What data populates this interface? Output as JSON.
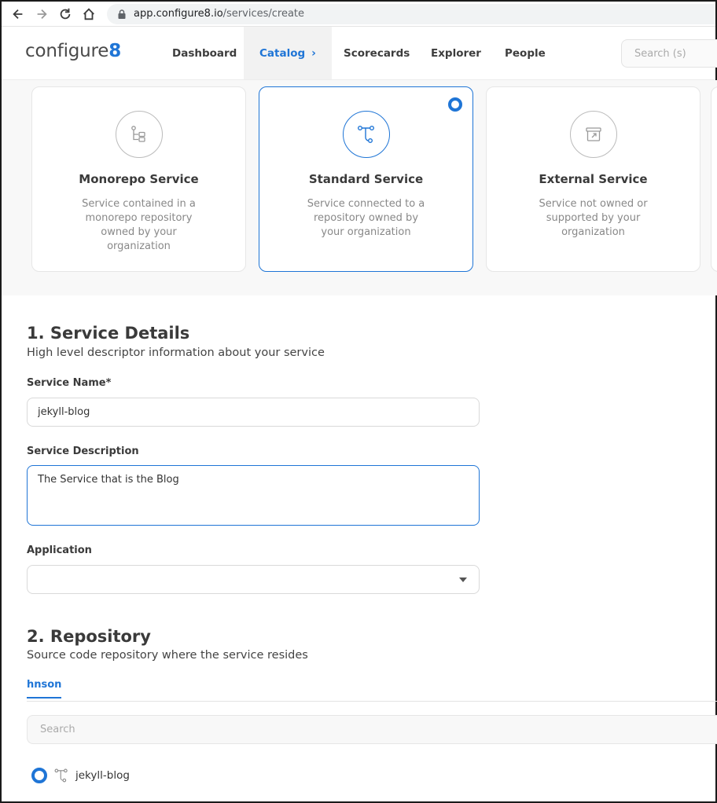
{
  "browser": {
    "url_host": "app.configure8.io",
    "url_path": "/services/create"
  },
  "header": {
    "logo_text": "configure",
    "logo_mark": "8",
    "nav": {
      "dashboard": "Dashboard",
      "catalog": "Catalog",
      "scorecards": "Scorecards",
      "explorer": "Explorer",
      "people": "People"
    },
    "search_placeholder": "Search (s)"
  },
  "service_types": [
    {
      "title": "Monorepo Service",
      "description": "Service contained in a monorepo repository owned by your organization",
      "icon": "monorepo-icon",
      "selected": false
    },
    {
      "title": "Standard Service",
      "description": "Service connected to a repository owned by your organization",
      "icon": "branch-icon",
      "selected": true
    },
    {
      "title": "External Service",
      "description": "Service not owned or supported by your organization",
      "icon": "external-box-icon",
      "selected": false
    }
  ],
  "service_details": {
    "title": "1. Service Details",
    "subtitle": "High level descriptor information about your service",
    "name_label": "Service Name*",
    "name_value": "jekyll-blog",
    "description_label": "Service Description",
    "description_value": "The Service that is the Blog",
    "application_label": "Application",
    "application_value": ""
  },
  "repository": {
    "title": "2. Repository",
    "subtitle": "Source code repository where the service resides",
    "tab": "hnson",
    "search_placeholder": "Search",
    "items": [
      {
        "name": "jekyll-blog",
        "selected": true
      }
    ]
  },
  "colors": {
    "accent": "#1f75d6",
    "text": "#333333",
    "muted": "#888888"
  }
}
